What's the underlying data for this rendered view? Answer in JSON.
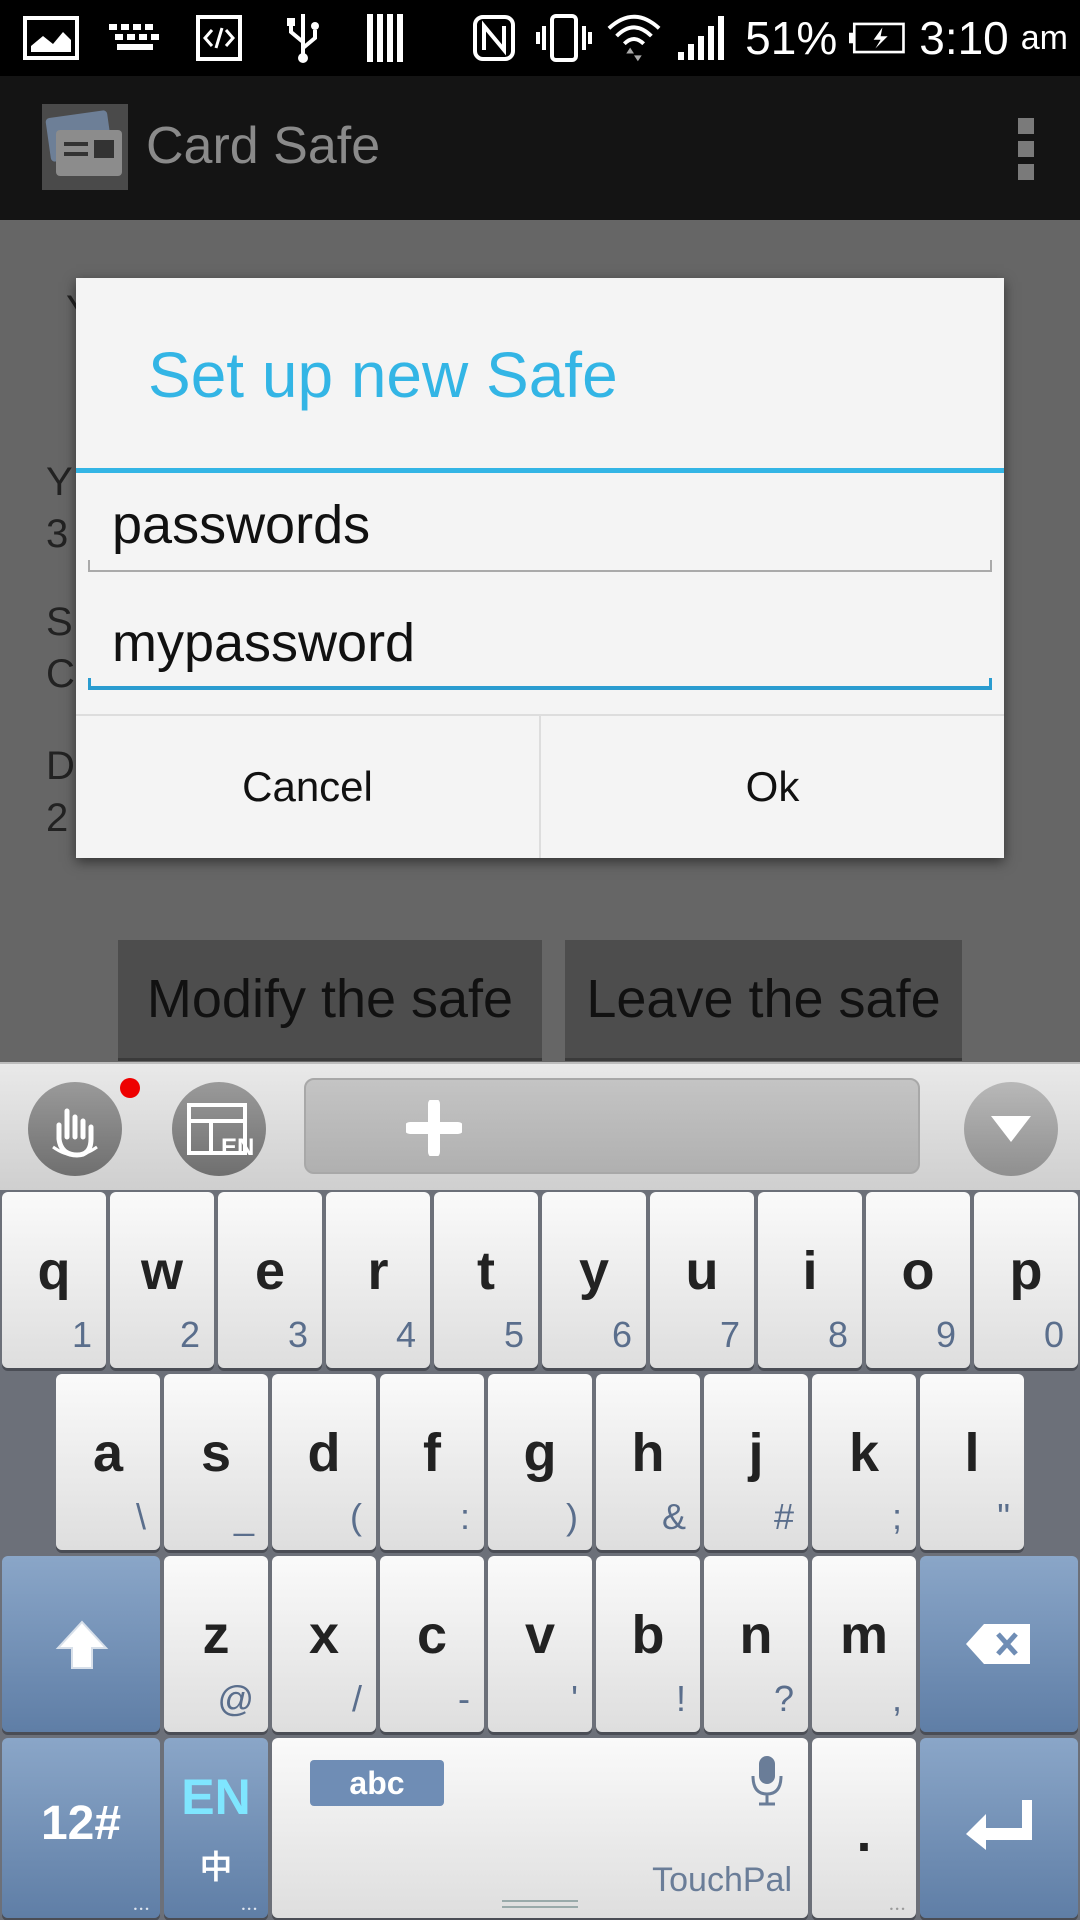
{
  "statusbar": {
    "battery": "51%",
    "time": "3:10",
    "ampm": "am",
    "icons": [
      "image-icon",
      "keyboard-icon",
      "code-icon",
      "usb-icon",
      "storage-icon",
      "nfc-icon",
      "vibrate-icon",
      "wifi-icon",
      "signal-icon",
      "battery-charging-icon"
    ]
  },
  "actionbar": {
    "title": "Card Safe"
  },
  "background": {
    "text_lines": [
      "Y",
      "Y",
      "3",
      "S",
      "C",
      "D",
      "2"
    ],
    "modify_button": "Modify the safe",
    "leave_button": "Leave the safe"
  },
  "dialog": {
    "title": "Set up new Safe",
    "name_field": "passwords",
    "password_field": "mypassword",
    "cancel": "Cancel",
    "ok": "Ok"
  },
  "keyboard": {
    "row1": [
      {
        "k": "q",
        "s": "1"
      },
      {
        "k": "w",
        "s": "2"
      },
      {
        "k": "e",
        "s": "3"
      },
      {
        "k": "r",
        "s": "4"
      },
      {
        "k": "t",
        "s": "5"
      },
      {
        "k": "y",
        "s": "6"
      },
      {
        "k": "u",
        "s": "7"
      },
      {
        "k": "i",
        "s": "8"
      },
      {
        "k": "o",
        "s": "9"
      },
      {
        "k": "p",
        "s": "0"
      }
    ],
    "row2": [
      {
        "k": "a",
        "s": "\\"
      },
      {
        "k": "s",
        "s": "_"
      },
      {
        "k": "d",
        "s": "("
      },
      {
        "k": "f",
        "s": ":"
      },
      {
        "k": "g",
        "s": ")"
      },
      {
        "k": "h",
        "s": "&"
      },
      {
        "k": "j",
        "s": "#"
      },
      {
        "k": "k",
        "s": ";"
      },
      {
        "k": "l",
        "s": "\""
      }
    ],
    "row3": [
      {
        "k": "z",
        "s": "@"
      },
      {
        "k": "x",
        "s": "/"
      },
      {
        "k": "c",
        "s": "-"
      },
      {
        "k": "v",
        "s": "'"
      },
      {
        "k": "b",
        "s": "!"
      },
      {
        "k": "n",
        "s": "?"
      },
      {
        "k": "m",
        "s": ","
      }
    ],
    "num_key": "12#",
    "lang_key": "EN",
    "lang_sub": "中",
    "abc_label": "abc",
    "space_brand": "TouchPal",
    "period": ".",
    "dots": "...",
    "toolbar_lang_badge": "EN"
  },
  "colors": {
    "accent": "#33b5e5",
    "keyboard_bg": "#6c7079",
    "dark_key": "#6f8db5"
  }
}
